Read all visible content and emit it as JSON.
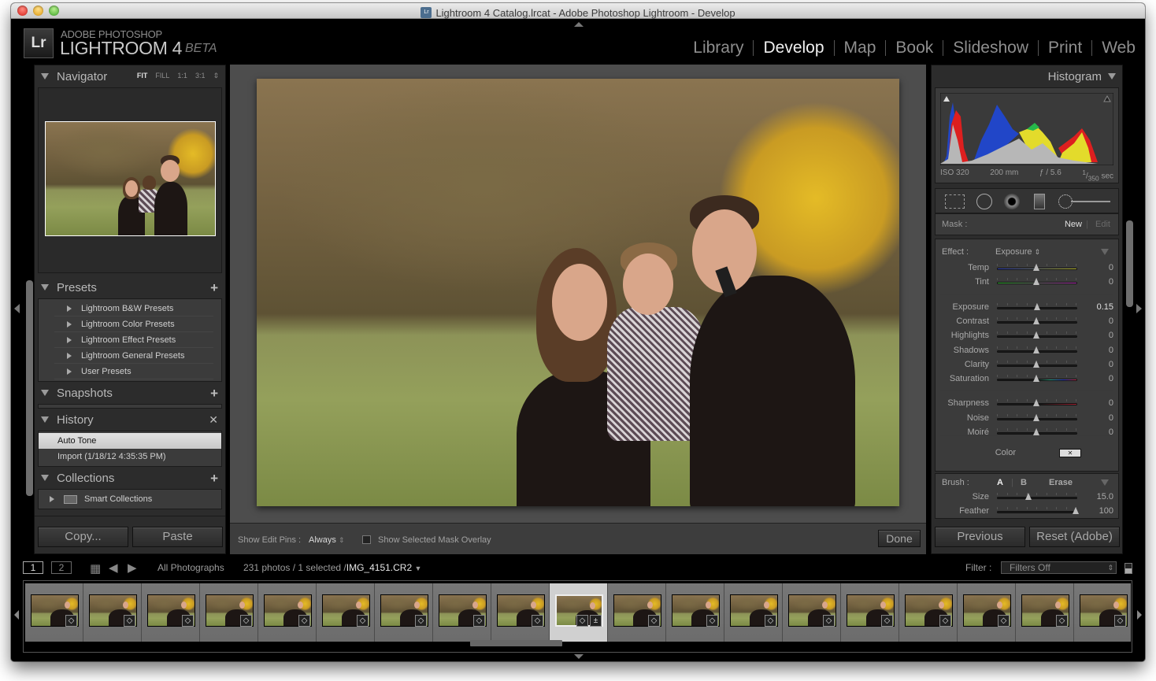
{
  "window": {
    "title": "Lightroom 4 Catalog.lrcat - Adobe Photoshop Lightroom - Develop",
    "doc_icon": "Lr"
  },
  "identity_plate": {
    "logo": "Lr",
    "line1": "ADOBE PHOTOSHOP",
    "line2": "LIGHTROOM 4",
    "badge": "BETA"
  },
  "modules": [
    {
      "label": "Library",
      "active": false
    },
    {
      "label": "Develop",
      "active": true
    },
    {
      "label": "Map",
      "active": false
    },
    {
      "label": "Book",
      "active": false
    },
    {
      "label": "Slideshow",
      "active": false
    },
    {
      "label": "Print",
      "active": false
    },
    {
      "label": "Web",
      "active": false
    }
  ],
  "left_panel": {
    "navigator": {
      "title": "Navigator",
      "zoom_options": [
        "FIT",
        "FILL",
        "1:1",
        "3:1"
      ],
      "zoom_selected": "FIT"
    },
    "presets": {
      "title": "Presets",
      "items": [
        "Lightroom B&W Presets",
        "Lightroom Color Presets",
        "Lightroom Effect Presets",
        "Lightroom General Presets",
        "User Presets"
      ]
    },
    "snapshots": {
      "title": "Snapshots"
    },
    "history": {
      "title": "History",
      "items": [
        "Auto Tone",
        "Import (1/18/12 4:35:35 PM)"
      ],
      "selected": "Auto Tone"
    },
    "collections": {
      "title": "Collections",
      "items": [
        "Smart Collections"
      ]
    },
    "copy_label": "Copy...",
    "paste_label": "Paste"
  },
  "toolbar": {
    "edit_pins_label": "Show Edit Pins :",
    "edit_pins_value": "Always",
    "mask_overlay_label": "Show Selected Mask Overlay",
    "mask_overlay_checked": false,
    "done_label": "Done"
  },
  "right_panel": {
    "histogram": {
      "title": "Histogram",
      "iso": "ISO 320",
      "focal": "200 mm",
      "aperture": "ƒ / 5.6",
      "shutter_num": "1",
      "shutter_den": "350",
      "shutter_unit": "sec"
    },
    "mask": {
      "label": "Mask :",
      "new": "New",
      "edit": "Edit"
    },
    "effect": {
      "label": "Effect :",
      "value": "Exposure",
      "groups": [
        [
          {
            "label": "Temp",
            "value": "0",
            "pos": 0.5
          },
          {
            "label": "Tint",
            "value": "0",
            "pos": 0.5
          }
        ],
        [
          {
            "label": "Exposure",
            "value": "0.15",
            "pos": 0.51
          },
          {
            "label": "Contrast",
            "value": "0",
            "pos": 0.5
          },
          {
            "label": "Highlights",
            "value": "0",
            "pos": 0.5
          },
          {
            "label": "Shadows",
            "value": "0",
            "pos": 0.5
          },
          {
            "label": "Clarity",
            "value": "0",
            "pos": 0.5
          },
          {
            "label": "Saturation",
            "value": "0",
            "pos": 0.5
          }
        ],
        [
          {
            "label": "Sharpness",
            "value": "0",
            "pos": 0.5
          },
          {
            "label": "Noise",
            "value": "0",
            "pos": 0.5
          },
          {
            "label": "Moiré",
            "value": "0",
            "pos": 0.5
          }
        ]
      ],
      "color_label": "Color"
    },
    "brush": {
      "label": "Brush :",
      "a": "A",
      "b": "B",
      "erase": "Erase",
      "sliders": [
        {
          "label": "Size",
          "value": "15.0",
          "pos": 0.4
        },
        {
          "label": "Feather",
          "value": "100",
          "pos": 1.0
        }
      ]
    },
    "previous_label": "Previous",
    "reset_label": "Reset (Adobe)"
  },
  "filmstrip": {
    "view1": "1",
    "view2": "2",
    "source": "All Photographs",
    "count": "231 photos / 1 selected /",
    "filename": "IMG_4151.CR2",
    "filter_label": "Filter :",
    "filter_value": "Filters Off",
    "thumb_count": 19,
    "selected_index": 9
  }
}
